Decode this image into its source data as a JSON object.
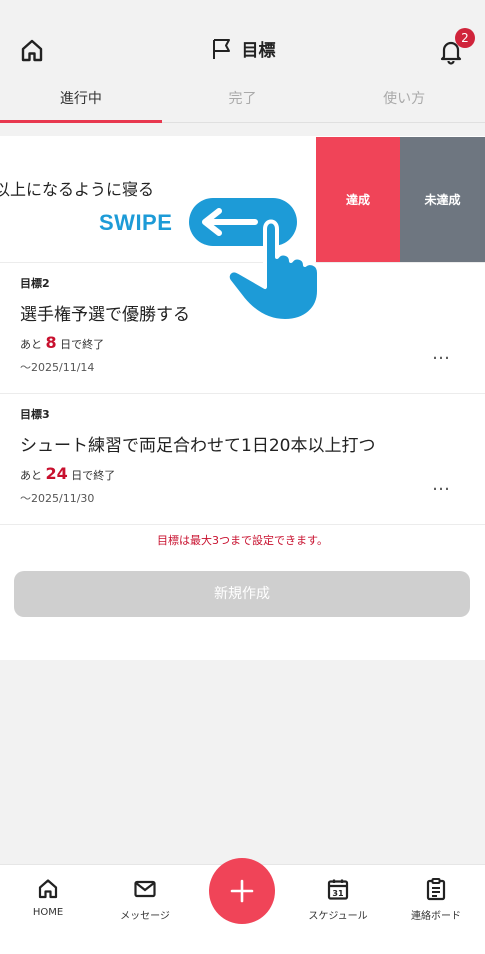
{
  "header": {
    "title": "目標",
    "notification_count": "2"
  },
  "tabs": [
    {
      "label": "進行中",
      "active": true
    },
    {
      "label": "完了",
      "active": false
    },
    {
      "label": "使い方",
      "active": false
    }
  ],
  "goals": {
    "row1": {
      "title_partial": "以上になるように寝る",
      "actions": {
        "done": "達成",
        "not_done": "未達成"
      }
    },
    "items": [
      {
        "label": "目標2",
        "title": "選手権予選で優勝する",
        "remain_prefix": "あと",
        "remain_days": "8",
        "remain_suffix": "日で終了",
        "end_date": "〜2025/11/14"
      },
      {
        "label": "目標3",
        "title": "シュート練習で両足合わせて1日20本以上打つ",
        "remain_prefix": "あと",
        "remain_days": "24",
        "remain_suffix": "日で終了",
        "end_date": "〜2025/11/30"
      }
    ],
    "more_icon": "…",
    "limit_note": "目標は最大3つまで設定できます。",
    "new_button": "新規作成"
  },
  "swipe_hint": {
    "text": "SWIPE",
    "color": "#1d9bd7"
  },
  "bottom_nav": {
    "home": "HOME",
    "messages": "メッセージ",
    "schedule": "スケジュール",
    "calendar_day": "31",
    "board": "連絡ボード"
  },
  "colors": {
    "accent": "#f04458",
    "badge": "#d0243b",
    "deadline_number": "#c8102e",
    "not_done_button": "#6e7680"
  }
}
